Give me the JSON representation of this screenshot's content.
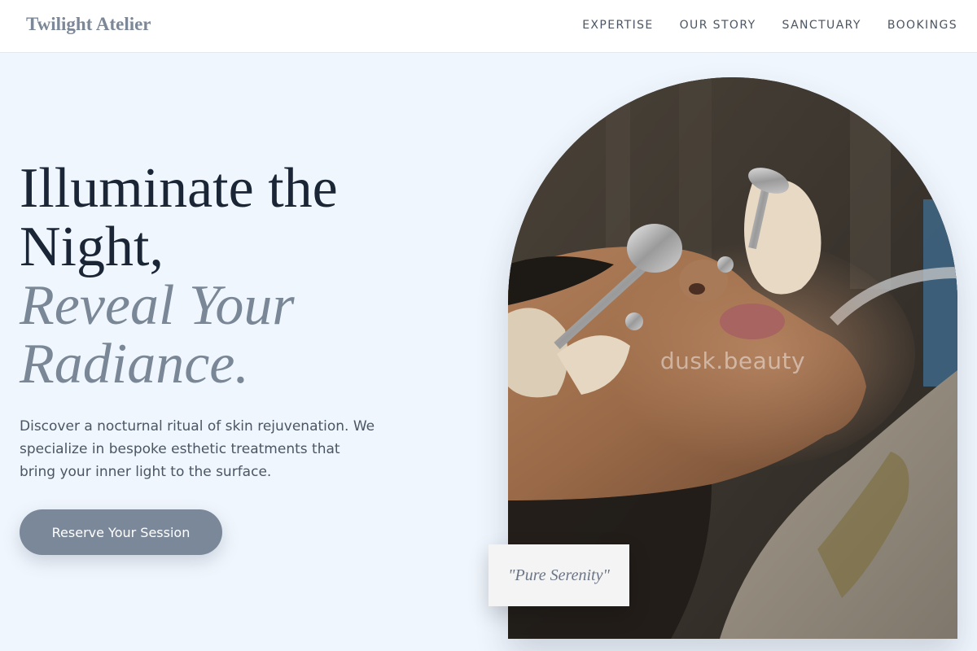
{
  "header": {
    "brand": "Twilight Atelier",
    "nav": [
      "EXPERTISE",
      "OUR STORY",
      "SANCTUARY",
      "BOOKINGS"
    ]
  },
  "hero": {
    "headline_line1": "Illuminate the",
    "headline_line2": "Night,",
    "headline_accent_line1": "Reveal Your",
    "headline_accent_line2": "Radiance.",
    "description": "Discover a nocturnal ritual of skin rejuvenation. We specialize in bespoke esthetic treatments that bring your inner light to the surface.",
    "cta_label": "Reserve Your Session"
  },
  "image": {
    "subject": "facial-treatment-photo",
    "watermark": "dusk.beauty"
  },
  "quote_card": {
    "text": "\"Pure Serenity\""
  },
  "colors": {
    "background": "#f0f6fd",
    "accent": "#7b8899",
    "heading": "#1a2536"
  }
}
